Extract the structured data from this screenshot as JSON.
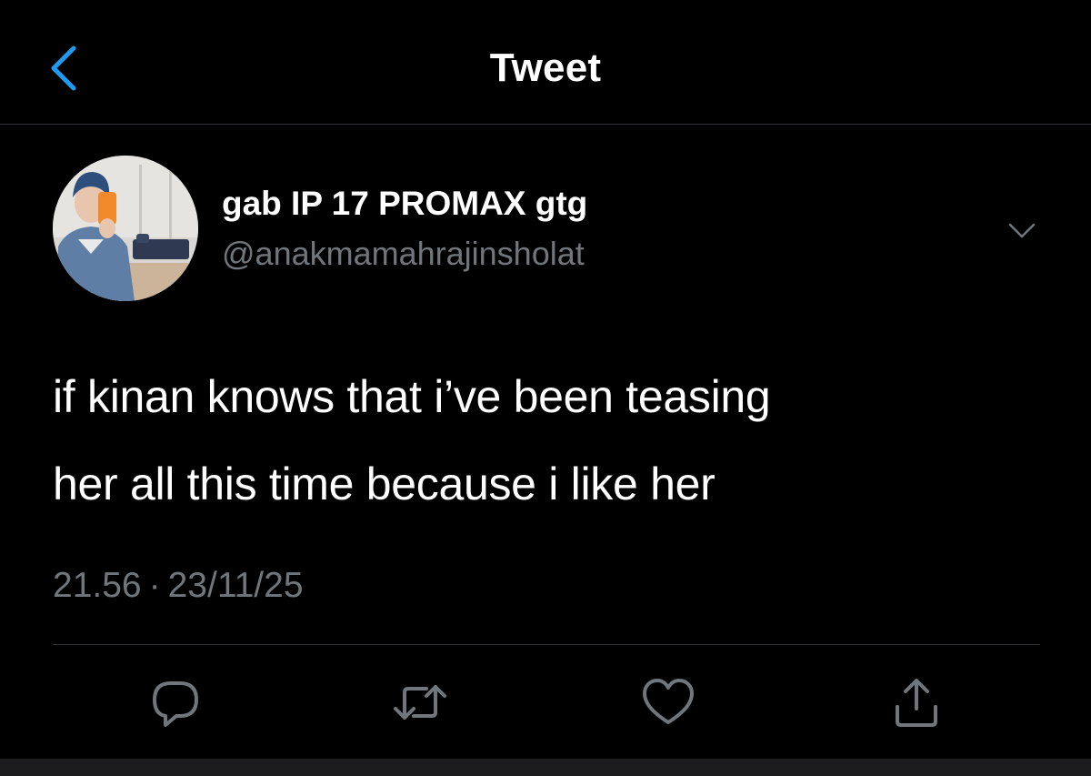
{
  "header": {
    "title": "Tweet",
    "back_icon": "chevron-left-icon",
    "accent_color": "#1d9bf0"
  },
  "author": {
    "display_name": "gab IP 17 PROMAX gtg",
    "handle": "@anakmamahrajinsholat",
    "avatar": "profile-photo-mirror-selfie"
  },
  "tweet": {
    "lines": [
      "if kinan knows that i’ve been teasing",
      "her all this time because i like her"
    ],
    "time": "21.56",
    "separator": "·",
    "date": "23/11/25"
  },
  "actions": [
    {
      "icon": "reply-icon"
    },
    {
      "icon": "retweet-icon"
    },
    {
      "icon": "like-icon"
    },
    {
      "icon": "share-icon"
    }
  ],
  "colors": {
    "background": "#000000",
    "text": "#ffffff",
    "secondary_text": "#71767b",
    "divider": "#2f3336"
  }
}
